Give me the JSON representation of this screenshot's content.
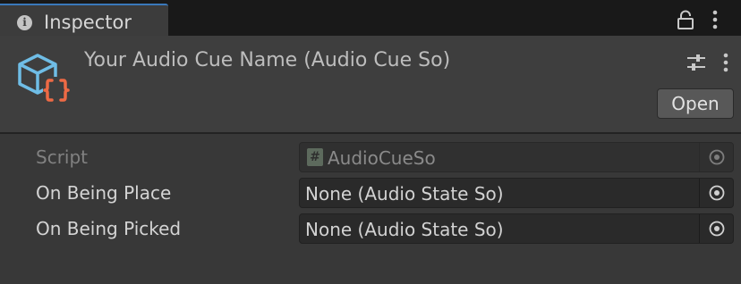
{
  "window": {
    "tab_label": "Inspector",
    "tab_icon_glyph": "i",
    "icons": [
      "info-icon",
      "lock-icon",
      "kebab-menu-icon"
    ]
  },
  "header": {
    "asset_title": "Your Audio Cue Name (Audio Cue So)",
    "asset_icon": "scriptable-object-icon",
    "open_button_label": "Open",
    "icons": [
      "settings-sliders-icon",
      "kebab-menu-icon"
    ]
  },
  "properties": [
    {
      "label": "Script",
      "value": "AudioCueSo",
      "disabled": true,
      "value_icon": "script-hash-icon",
      "value_icon_glyph": "#"
    },
    {
      "label": "On Being Place",
      "value": "None (Audio State So)",
      "disabled": false
    },
    {
      "label": "On Being Picked",
      "value": "None (Audio State So)",
      "disabled": false
    }
  ],
  "colors": {
    "accent_tab_line": "#3a79bb",
    "panel_bg": "#383838",
    "icon_cube_blue": "#6fbde6",
    "icon_brace_orange": "#ee6a45"
  }
}
